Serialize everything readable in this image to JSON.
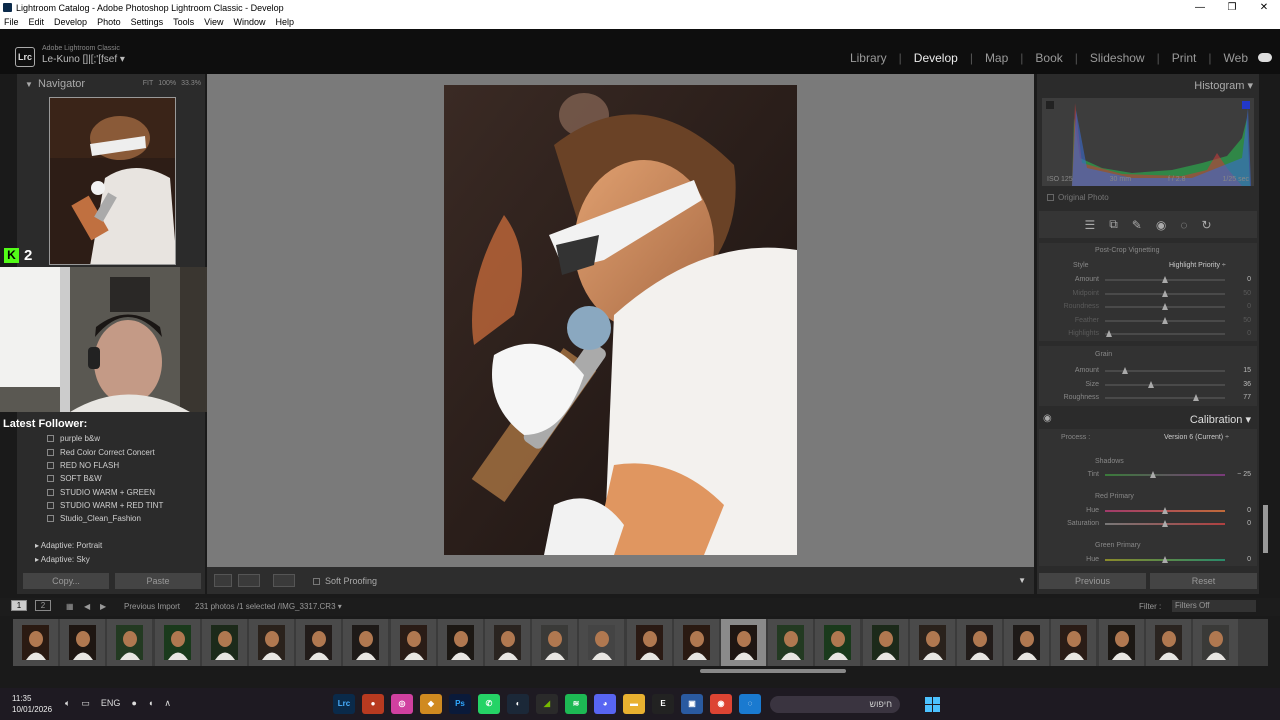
{
  "window": {
    "title": "Lightroom Catalog - Adobe Photoshop Lightroom Classic - Develop",
    "minimize": "—",
    "restore": "❐",
    "close": "✕"
  },
  "menu": [
    "File",
    "Edit",
    "Develop",
    "Photo",
    "Settings",
    "Tools",
    "View",
    "Window",
    "Help"
  ],
  "identity": {
    "badge": "Lrc",
    "product": "Adobe Lightroom Classic",
    "catalog": "Le-Kuno []|[;'[fsef"
  },
  "modules": [
    "Library",
    "Develop",
    "Map",
    "Book",
    "Slideshow",
    "Print",
    "Web"
  ],
  "active_module": "Develop",
  "navigator": {
    "title": "Navigator",
    "zoom": [
      "FIT",
      "100%",
      "33.3%"
    ]
  },
  "stream": {
    "kick_count": "2",
    "kick_logo": "K",
    "follower_label": "Latest Follower:"
  },
  "presets": [
    "purple b&w",
    "Red Color Correct Concert",
    "RED NO FLASH",
    "SOFT B&W",
    "STUDIO WARM + GREEN",
    "STUDIO WARM + RED TINT",
    "Studio_Clean_Fashion"
  ],
  "adaptive": [
    "Adaptive: Portrait",
    "Adaptive: Sky"
  ],
  "left_buttons": {
    "copy": "Copy...",
    "paste": "Paste"
  },
  "toolbar": {
    "soft_proofing": "Soft Proofing"
  },
  "histogram": {
    "title": "Histogram",
    "iso": "ISO 125",
    "focal": "30 mm",
    "aperture": "f / 2.8",
    "shutter": "1/25 sec",
    "original_photo": "Original Photo"
  },
  "post_crop": {
    "title": "Post-Crop Vignetting",
    "style_label": "Style",
    "style_value": "Highlight Priority ÷",
    "sliders": [
      {
        "label": "Amount",
        "value": "0",
        "pos": 0.5
      },
      {
        "label": "Midpoint",
        "value": "50",
        "pos": 0.5
      },
      {
        "label": "Roundness",
        "value": "0",
        "pos": 0.5
      },
      {
        "label": "Feather",
        "value": "50",
        "pos": 0.5
      },
      {
        "label": "Highlights",
        "value": "0",
        "pos": 0.03
      }
    ]
  },
  "grain": {
    "title": "Grain",
    "sliders": [
      {
        "label": "Amount",
        "value": "15",
        "pos": 0.17
      },
      {
        "label": "Size",
        "value": "36",
        "pos": 0.38
      },
      {
        "label": "Roughness",
        "value": "77",
        "pos": 0.76
      }
    ]
  },
  "calibration": {
    "title": "Calibration",
    "process_label": "Process :",
    "process_value": "Version 6 (Current) ÷",
    "shadows_title": "Shadows",
    "tint_label": "Tint",
    "tint_value": "− 25",
    "red_title": "Red Primary",
    "red": [
      {
        "label": "Hue",
        "value": "0"
      },
      {
        "label": "Saturation",
        "value": "0"
      }
    ],
    "green_title": "Green Primary",
    "green_hue_label": "Hue",
    "green_hue_value": "0"
  },
  "right_buttons": {
    "previous": "Previous",
    "reset": "Reset"
  },
  "filmstrip": {
    "page1": "1",
    "page2": "2",
    "source": "Previous Import",
    "count": "231 photos /1 selected /IMG_3317.CR3 ▾",
    "filter_label": "Filter :",
    "filter_value": "Filters Off",
    "selected_index": 15,
    "thumbs": 26
  },
  "taskbar": {
    "time": "11:35",
    "date": "10/01/2026",
    "lang": "ENG",
    "search_text": "חיפוש"
  },
  "colors": {
    "accent_kick": "#53fc18",
    "win_blue": "#4cc2ff"
  }
}
